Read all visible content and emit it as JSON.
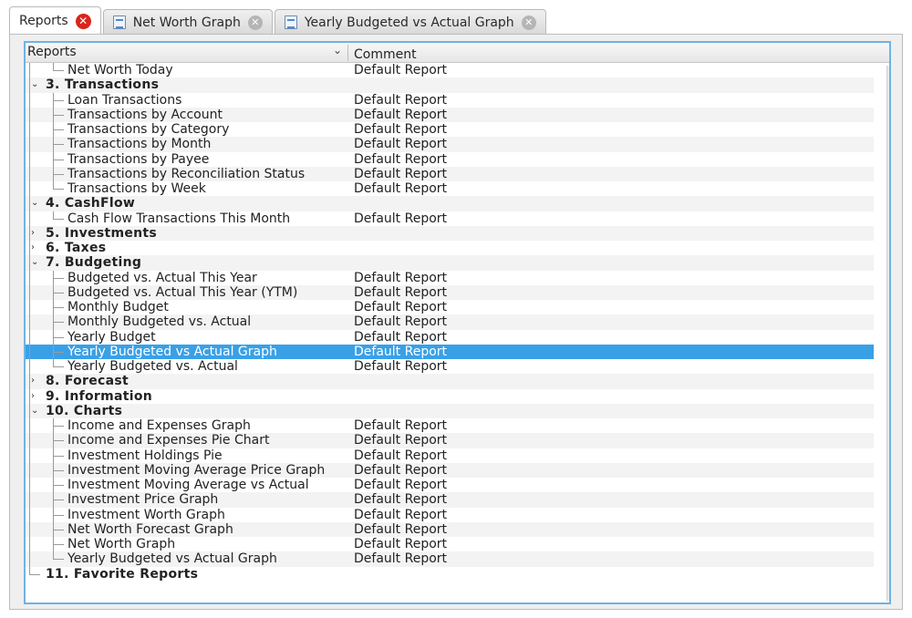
{
  "tabs": [
    {
      "label": "Reports",
      "close": "close-red",
      "icon": false,
      "active": true
    },
    {
      "label": "Net Worth Graph",
      "close": "close-grey",
      "icon": true,
      "active": false
    },
    {
      "label": "Yearly Budgeted vs Actual Graph",
      "close": "close-grey",
      "icon": true,
      "active": false
    }
  ],
  "header": {
    "col1": "Reports",
    "col2": "Comment",
    "sort_glyph": "⌄"
  },
  "rows": [
    {
      "name": "Net Worth Today",
      "comment": "Default Report",
      "level": 2,
      "cat": false
    },
    {
      "name": "3. Transactions",
      "comment": "",
      "level": 1,
      "cat": true,
      "expanded": true
    },
    {
      "name": "Loan Transactions",
      "comment": "Default Report",
      "level": 2,
      "cat": false
    },
    {
      "name": "Transactions by Account",
      "comment": "Default Report",
      "level": 2,
      "cat": false
    },
    {
      "name": "Transactions by Category",
      "comment": "Default Report",
      "level": 2,
      "cat": false
    },
    {
      "name": "Transactions by Month",
      "comment": "Default Report",
      "level": 2,
      "cat": false
    },
    {
      "name": "Transactions by Payee",
      "comment": "Default Report",
      "level": 2,
      "cat": false
    },
    {
      "name": "Transactions by Reconciliation Status",
      "comment": "Default Report",
      "level": 2,
      "cat": false
    },
    {
      "name": "Transactions by Week",
      "comment": "Default Report",
      "level": 2,
      "cat": false
    },
    {
      "name": "4. CashFlow",
      "comment": "",
      "level": 1,
      "cat": true,
      "expanded": true
    },
    {
      "name": "Cash Flow Transactions This Month",
      "comment": "Default Report",
      "level": 2,
      "cat": false
    },
    {
      "name": "5. Investments",
      "comment": "",
      "level": 1,
      "cat": true,
      "expanded": false
    },
    {
      "name": "6. Taxes",
      "comment": "",
      "level": 1,
      "cat": true,
      "expanded": false
    },
    {
      "name": "7. Budgeting",
      "comment": "",
      "level": 1,
      "cat": true,
      "expanded": true
    },
    {
      "name": "Budgeted vs. Actual This Year",
      "comment": "Default Report",
      "level": 2,
      "cat": false
    },
    {
      "name": "Budgeted vs. Actual This Year (YTM)",
      "comment": "Default Report",
      "level": 2,
      "cat": false
    },
    {
      "name": "Monthly Budget",
      "comment": "Default Report",
      "level": 2,
      "cat": false
    },
    {
      "name": "Monthly Budgeted vs. Actual",
      "comment": "Default Report",
      "level": 2,
      "cat": false
    },
    {
      "name": "Yearly Budget",
      "comment": "Default Report",
      "level": 2,
      "cat": false
    },
    {
      "name": "Yearly Budgeted vs Actual Graph",
      "comment": "Default Report",
      "level": 2,
      "cat": false,
      "selected": true
    },
    {
      "name": "Yearly Budgeted vs. Actual",
      "comment": "Default Report",
      "level": 2,
      "cat": false
    },
    {
      "name": "8. Forecast",
      "comment": "",
      "level": 1,
      "cat": true,
      "expanded": false
    },
    {
      "name": "9. Information",
      "comment": "",
      "level": 1,
      "cat": true,
      "expanded": false
    },
    {
      "name": "10. Charts",
      "comment": "",
      "level": 1,
      "cat": true,
      "expanded": true
    },
    {
      "name": "Income and Expenses Graph",
      "comment": "Default Report",
      "level": 2,
      "cat": false
    },
    {
      "name": "Income and Expenses Pie Chart",
      "comment": "Default Report",
      "level": 2,
      "cat": false
    },
    {
      "name": "Investment Holdings Pie",
      "comment": "Default Report",
      "level": 2,
      "cat": false
    },
    {
      "name": "Investment Moving Average Price Graph",
      "comment": "Default Report",
      "level": 2,
      "cat": false
    },
    {
      "name": "Investment Moving Average vs Actual",
      "comment": "Default Report",
      "level": 2,
      "cat": false
    },
    {
      "name": "Investment Price Graph",
      "comment": "Default Report",
      "level": 2,
      "cat": false
    },
    {
      "name": "Investment Worth Graph",
      "comment": "Default Report",
      "level": 2,
      "cat": false
    },
    {
      "name": "Net Worth Forecast Graph",
      "comment": "Default Report",
      "level": 2,
      "cat": false
    },
    {
      "name": "Net Worth Graph",
      "comment": "Default Report",
      "level": 2,
      "cat": false
    },
    {
      "name": "Yearly Budgeted vs Actual Graph",
      "comment": "Default Report",
      "level": 2,
      "cat": false
    },
    {
      "name": "11. Favorite Reports",
      "comment": "",
      "level": 1,
      "cat": true,
      "expanded": null
    }
  ],
  "colors": {
    "selection": "#3aa0e6",
    "focus_border": "#6fb3e3",
    "close_red": "#d9251d"
  }
}
